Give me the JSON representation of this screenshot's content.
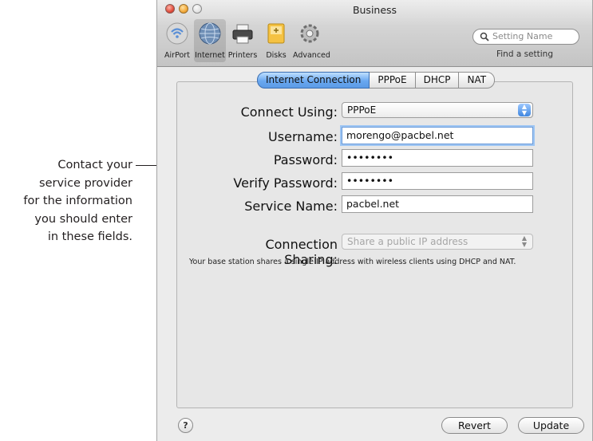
{
  "callout": {
    "lines": [
      "Contact your",
      "service provider",
      "for the information",
      "you should enter",
      "in these fields."
    ]
  },
  "window": {
    "title": "Business",
    "toolbar": [
      {
        "label": "AirPort",
        "icon": "airport-icon"
      },
      {
        "label": "Internet",
        "icon": "internet-globe-icon",
        "selected": true
      },
      {
        "label": "Printers",
        "icon": "printer-icon"
      },
      {
        "label": "Disks",
        "icon": "disk-icon"
      },
      {
        "label": "Advanced",
        "icon": "gear-icon"
      }
    ],
    "search": {
      "placeholder": "Setting Name",
      "caption": "Find a setting"
    },
    "tabs": [
      "Internet Connection",
      "PPPoE",
      "DHCP",
      "NAT"
    ],
    "active_tab": "Internet Connection",
    "form": {
      "connect_using": {
        "label": "Connect Using:",
        "value": "PPPoE"
      },
      "username": {
        "label": "Username:",
        "value": "morengo@pacbel.net"
      },
      "password": {
        "label": "Password:",
        "value": "••••••••"
      },
      "verify_password": {
        "label": "Verify Password:",
        "value": "••••••••"
      },
      "service_name": {
        "label": "Service Name:",
        "value": "pacbel.net"
      },
      "connection_sharing": {
        "label": "Connection Sharing:",
        "value": "Share a public IP address"
      }
    },
    "note": "Your base station shares a single IP address with wireless clients using DHCP and NAT.",
    "buttons": {
      "help": "?",
      "revert": "Revert",
      "update": "Update"
    },
    "colors": {
      "accent": "#5b9be6",
      "close": "#e04b3a",
      "minimize": "#f2a93b"
    }
  }
}
